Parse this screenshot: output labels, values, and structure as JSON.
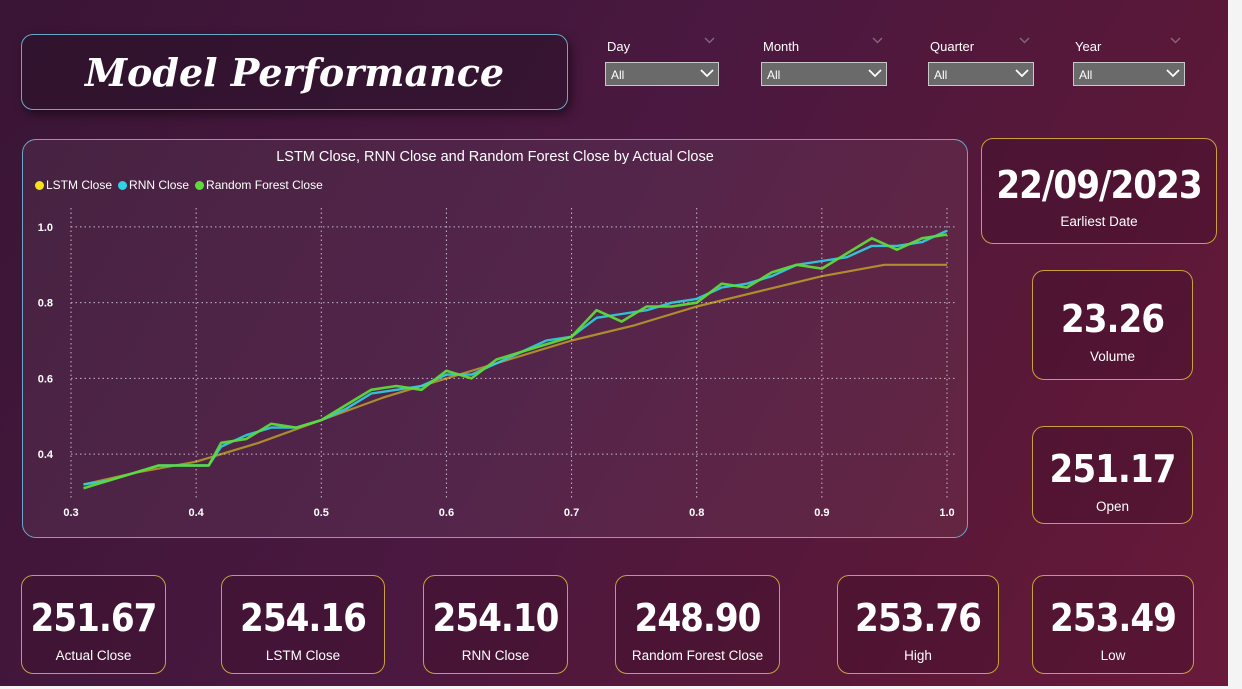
{
  "header": {
    "title": "Model Performance"
  },
  "slicers": [
    {
      "label": "Day",
      "value": "All"
    },
    {
      "label": "Month",
      "value": "All"
    },
    {
      "label": "Quarter",
      "value": "All"
    },
    {
      "label": "Year",
      "value": "All"
    }
  ],
  "kpis": {
    "earliest_date": {
      "value": "22/09/2023",
      "label": "Earliest Date"
    },
    "volume": {
      "value": "23.26",
      "label": "Volume"
    },
    "open": {
      "value": "251.17",
      "label": "Open"
    },
    "actual_close": {
      "value": "251.67",
      "label": "Actual Close"
    },
    "lstm_close": {
      "value": "254.16",
      "label": "LSTM Close"
    },
    "rnn_close": {
      "value": "254.10",
      "label": "RNN Close"
    },
    "random_forest_close": {
      "value": "248.90",
      "label": "Random Forest Close"
    },
    "high": {
      "value": "253.76",
      "label": "High"
    },
    "low": {
      "value": "253.49",
      "label": "Low"
    }
  },
  "colors": {
    "lstm": "#f5e21a",
    "rnn": "#2ed3e6",
    "random_forest": "#5fd93a",
    "card_border": "#c9a03a",
    "chart_border": "#6aa8c8"
  },
  "chart_data": {
    "type": "line",
    "title": "LSTM Close, RNN Close and Random Forest Close by Actual Close",
    "xlabel": "",
    "ylabel": "",
    "xlim": [
      0.3,
      1.0
    ],
    "ylim": [
      0.3,
      1.05
    ],
    "x_ticks": [
      "0.3",
      "0.4",
      "0.5",
      "0.6",
      "0.7",
      "0.8",
      "0.9",
      "1.0"
    ],
    "y_ticks": [
      "0.4",
      "0.6",
      "0.8",
      "1.0"
    ],
    "grid": true,
    "legend_position": "top-left",
    "series": [
      {
        "name": "LSTM Close",
        "color_key": "lstm",
        "points": [
          [
            0.31,
            0.32
          ],
          [
            0.35,
            0.35
          ],
          [
            0.4,
            0.38
          ],
          [
            0.45,
            0.43
          ],
          [
            0.5,
            0.49
          ],
          [
            0.55,
            0.55
          ],
          [
            0.6,
            0.6
          ],
          [
            0.65,
            0.65
          ],
          [
            0.7,
            0.7
          ],
          [
            0.75,
            0.74
          ],
          [
            0.8,
            0.79
          ],
          [
            0.85,
            0.83
          ],
          [
            0.9,
            0.87
          ],
          [
            0.95,
            0.9
          ],
          [
            1.0,
            0.9
          ]
        ]
      },
      {
        "name": "RNN Close",
        "color_key": "rnn",
        "points": [
          [
            0.31,
            0.32
          ],
          [
            0.33,
            0.33
          ],
          [
            0.35,
            0.35
          ],
          [
            0.37,
            0.37
          ],
          [
            0.4,
            0.37
          ],
          [
            0.41,
            0.37
          ],
          [
            0.42,
            0.42
          ],
          [
            0.44,
            0.45
          ],
          [
            0.46,
            0.47
          ],
          [
            0.48,
            0.47
          ],
          [
            0.5,
            0.49
          ],
          [
            0.52,
            0.52
          ],
          [
            0.54,
            0.56
          ],
          [
            0.56,
            0.57
          ],
          [
            0.58,
            0.58
          ],
          [
            0.6,
            0.61
          ],
          [
            0.62,
            0.61
          ],
          [
            0.64,
            0.64
          ],
          [
            0.66,
            0.67
          ],
          [
            0.68,
            0.7
          ],
          [
            0.7,
            0.71
          ],
          [
            0.72,
            0.76
          ],
          [
            0.74,
            0.77
          ],
          [
            0.76,
            0.78
          ],
          [
            0.78,
            0.8
          ],
          [
            0.8,
            0.81
          ],
          [
            0.82,
            0.84
          ],
          [
            0.84,
            0.85
          ],
          [
            0.86,
            0.87
          ],
          [
            0.88,
            0.9
          ],
          [
            0.9,
            0.91
          ],
          [
            0.92,
            0.92
          ],
          [
            0.94,
            0.95
          ],
          [
            0.96,
            0.95
          ],
          [
            0.98,
            0.96
          ],
          [
            1.0,
            0.99
          ]
        ]
      },
      {
        "name": "Random Forest Close",
        "color_key": "random_forest",
        "points": [
          [
            0.31,
            0.31
          ],
          [
            0.33,
            0.33
          ],
          [
            0.35,
            0.35
          ],
          [
            0.37,
            0.37
          ],
          [
            0.4,
            0.37
          ],
          [
            0.41,
            0.37
          ],
          [
            0.42,
            0.43
          ],
          [
            0.44,
            0.44
          ],
          [
            0.46,
            0.48
          ],
          [
            0.48,
            0.47
          ],
          [
            0.5,
            0.49
          ],
          [
            0.52,
            0.53
          ],
          [
            0.54,
            0.57
          ],
          [
            0.56,
            0.58
          ],
          [
            0.58,
            0.57
          ],
          [
            0.6,
            0.62
          ],
          [
            0.62,
            0.6
          ],
          [
            0.64,
            0.65
          ],
          [
            0.66,
            0.67
          ],
          [
            0.68,
            0.69
          ],
          [
            0.7,
            0.71
          ],
          [
            0.72,
            0.78
          ],
          [
            0.74,
            0.75
          ],
          [
            0.76,
            0.79
          ],
          [
            0.78,
            0.79
          ],
          [
            0.8,
            0.8
          ],
          [
            0.82,
            0.85
          ],
          [
            0.84,
            0.84
          ],
          [
            0.86,
            0.88
          ],
          [
            0.88,
            0.9
          ],
          [
            0.9,
            0.89
          ],
          [
            0.92,
            0.93
          ],
          [
            0.94,
            0.97
          ],
          [
            0.96,
            0.94
          ],
          [
            0.98,
            0.97
          ],
          [
            1.0,
            0.98
          ]
        ]
      }
    ]
  }
}
